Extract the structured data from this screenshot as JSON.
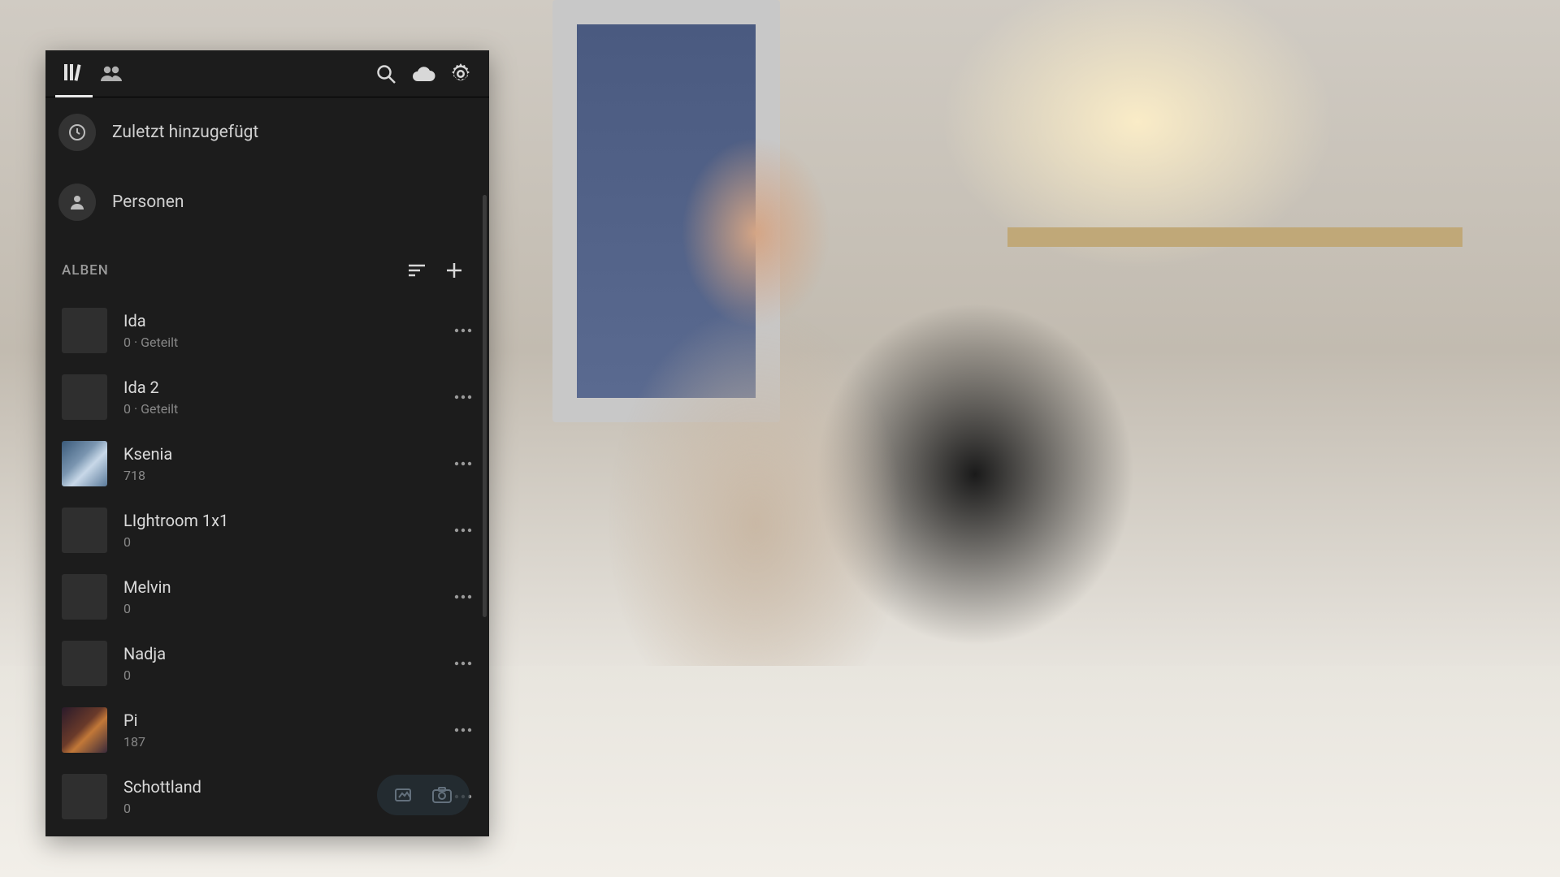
{
  "nav": {
    "recent_label": "Zuletzt hinzugefügt",
    "people_label": "Personen"
  },
  "albums_section": {
    "title": "ALBEN"
  },
  "albums": [
    {
      "name": "Ida",
      "meta": "0 · Geteilt",
      "thumb": ""
    },
    {
      "name": "Ida 2",
      "meta": "0 · Geteilt",
      "thumb": ""
    },
    {
      "name": "Ksenia",
      "meta": "718",
      "thumb": "ksenia"
    },
    {
      "name": "LIghtroom 1x1",
      "meta": "0",
      "thumb": ""
    },
    {
      "name": "Melvin",
      "meta": "0",
      "thumb": ""
    },
    {
      "name": "Nadja",
      "meta": "0",
      "thumb": ""
    },
    {
      "name": "Pi",
      "meta": "187",
      "thumb": "pi"
    },
    {
      "name": "Schottland",
      "meta": "0",
      "thumb": ""
    }
  ]
}
